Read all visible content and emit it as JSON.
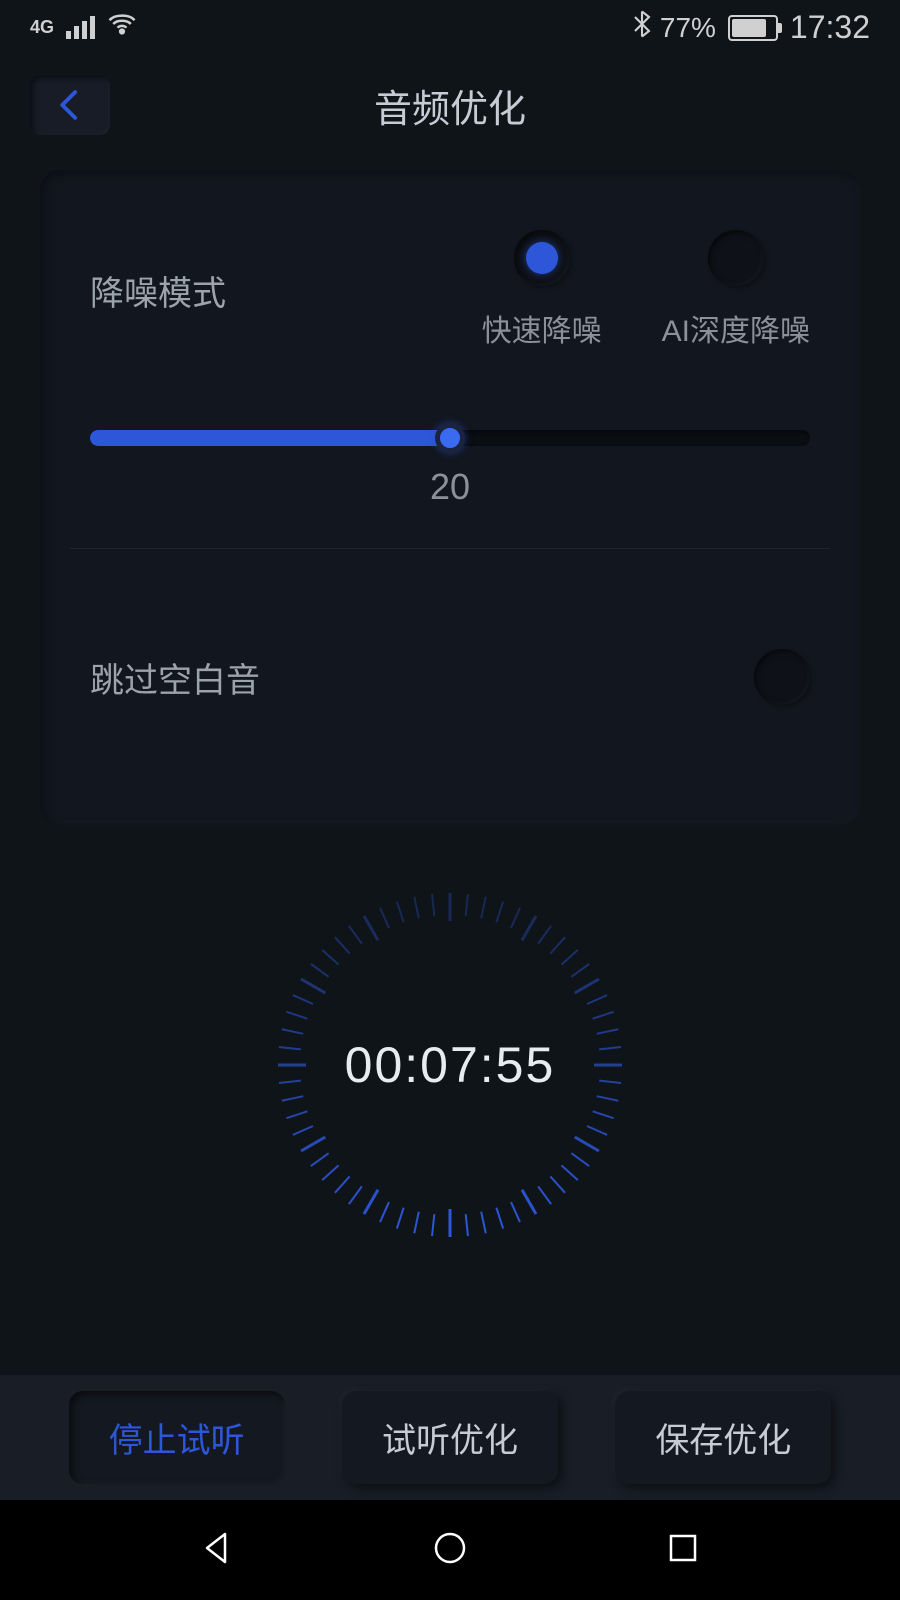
{
  "status": {
    "network": "4G",
    "battery": "77%",
    "time": "17:32"
  },
  "header": {
    "title": "音频优化"
  },
  "settings": {
    "noise_reduction": {
      "label": "降噪模式",
      "options": {
        "fast": "快速降噪",
        "ai_deep": "AI深度降噪"
      },
      "slider_value": "20",
      "slider_percent": 50
    },
    "skip_silence": {
      "label": "跳过空白音"
    }
  },
  "timer": {
    "display": "00:07:55"
  },
  "actions": {
    "stop_preview": "停止试听",
    "preview_optimize": "试听优化",
    "save_optimize": "保存优化"
  },
  "colors": {
    "accent": "#2d56d8",
    "bg": "#0f1419",
    "panel": "#12161e"
  }
}
